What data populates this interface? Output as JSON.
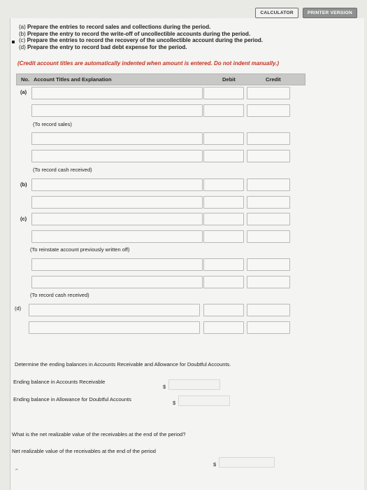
{
  "toolbar": {
    "calculator": "CALCULATOR",
    "printer_version": "PRINTER VERSION"
  },
  "instructions": [
    {
      "letter": "(a)",
      "text": "Prepare the entries to record sales and collections during the period."
    },
    {
      "letter": "(b)",
      "text": "Prepare the entry to record the write-off of uncollectible accounts during the period."
    },
    {
      "letter": "(c)",
      "text": "Prepare the entries to record the recovery of the uncollectible account during the period."
    },
    {
      "letter": "(d)",
      "text": "Prepare the entry to record bad debt expense for the period."
    }
  ],
  "note": "(Credit account titles are automatically indented when amount is entered. Do not indent manually.)",
  "table": {
    "col_no": "No.",
    "col_title": "Account Titles and Explanation",
    "col_debit": "Debit",
    "col_credit": "Credit"
  },
  "labels": {
    "a": "(a)",
    "b": "(b)",
    "c": "(c)",
    "d": "(d)"
  },
  "memos": {
    "sales": "(To record sales)",
    "cash1": "(To record cash received)",
    "reinstate": "(To reinstate account previously written off)",
    "cash2": "(To record cash received)"
  },
  "balances": {
    "prompt": "Determine the ending balances in Accounts Receivable and Allowance for Doubtful Accounts.",
    "ar_label": "Ending balance in Accounts Receivable",
    "allow_label": "Ending balance in Allowance for Doubtful Accounts",
    "currency": "$"
  },
  "nrv": {
    "question": "What is the net realizable value of the receivables at the end of the period?",
    "label": "Net realizable value of the receivables at the end of the period",
    "currency": "$"
  }
}
